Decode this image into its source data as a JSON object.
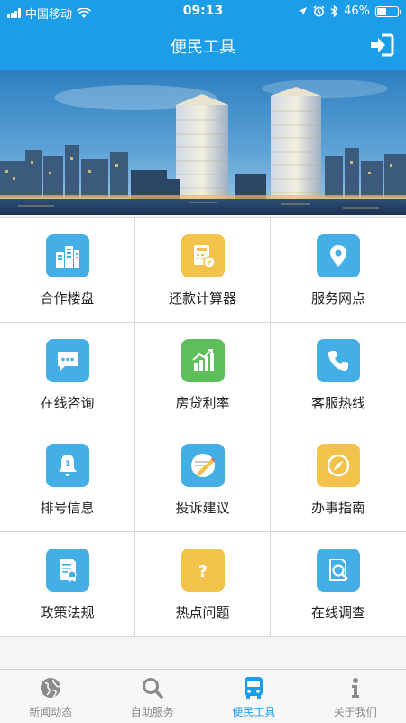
{
  "status_bar": {
    "carrier": "中国移动",
    "time": "09:13",
    "battery": "46%",
    "battery_level": 0.46
  },
  "header": {
    "title": "便民工具",
    "action_icon": "login-arrow-icon"
  },
  "colors": {
    "brand_blue": "#1c9de8",
    "icon_blue": "#44aee6",
    "icon_yellow": "#f2c24a",
    "icon_green": "#5cbf5a"
  },
  "tools": [
    {
      "label": "合作楼盘",
      "icon": "buildings-icon",
      "color": "#44aee6"
    },
    {
      "label": "还款计算器",
      "icon": "calculator-icon",
      "color": "#f2c24a"
    },
    {
      "label": "服务网点",
      "icon": "location-pin-icon",
      "color": "#44aee6"
    },
    {
      "label": "在线咨询",
      "icon": "chat-bubble-icon",
      "color": "#44aee6"
    },
    {
      "label": "房贷利率",
      "icon": "bar-chart-icon",
      "color": "#5cbf5a"
    },
    {
      "label": "客服热线",
      "icon": "phone-icon",
      "color": "#44aee6"
    },
    {
      "label": "排号信息",
      "icon": "bell-icon",
      "color": "#44aee6"
    },
    {
      "label": "投诉建议",
      "icon": "pen-icon",
      "color": "#44aee6"
    },
    {
      "label": "办事指南",
      "icon": "compass-icon",
      "color": "#f2c24a"
    },
    {
      "label": "政策法规",
      "icon": "certificate-icon",
      "color": "#44aee6"
    },
    {
      "label": "热点问题",
      "icon": "question-icon",
      "color": "#f2c24a"
    },
    {
      "label": "在线调查",
      "icon": "survey-search-icon",
      "color": "#44aee6"
    }
  ],
  "tabs": [
    {
      "label": "新闻动态",
      "icon": "globe-icon",
      "active": false
    },
    {
      "label": "自助服务",
      "icon": "magnifier-icon",
      "active": false
    },
    {
      "label": "便民工具",
      "icon": "bus-icon",
      "active": true
    },
    {
      "label": "关于我们",
      "icon": "info-icon",
      "active": false
    }
  ]
}
